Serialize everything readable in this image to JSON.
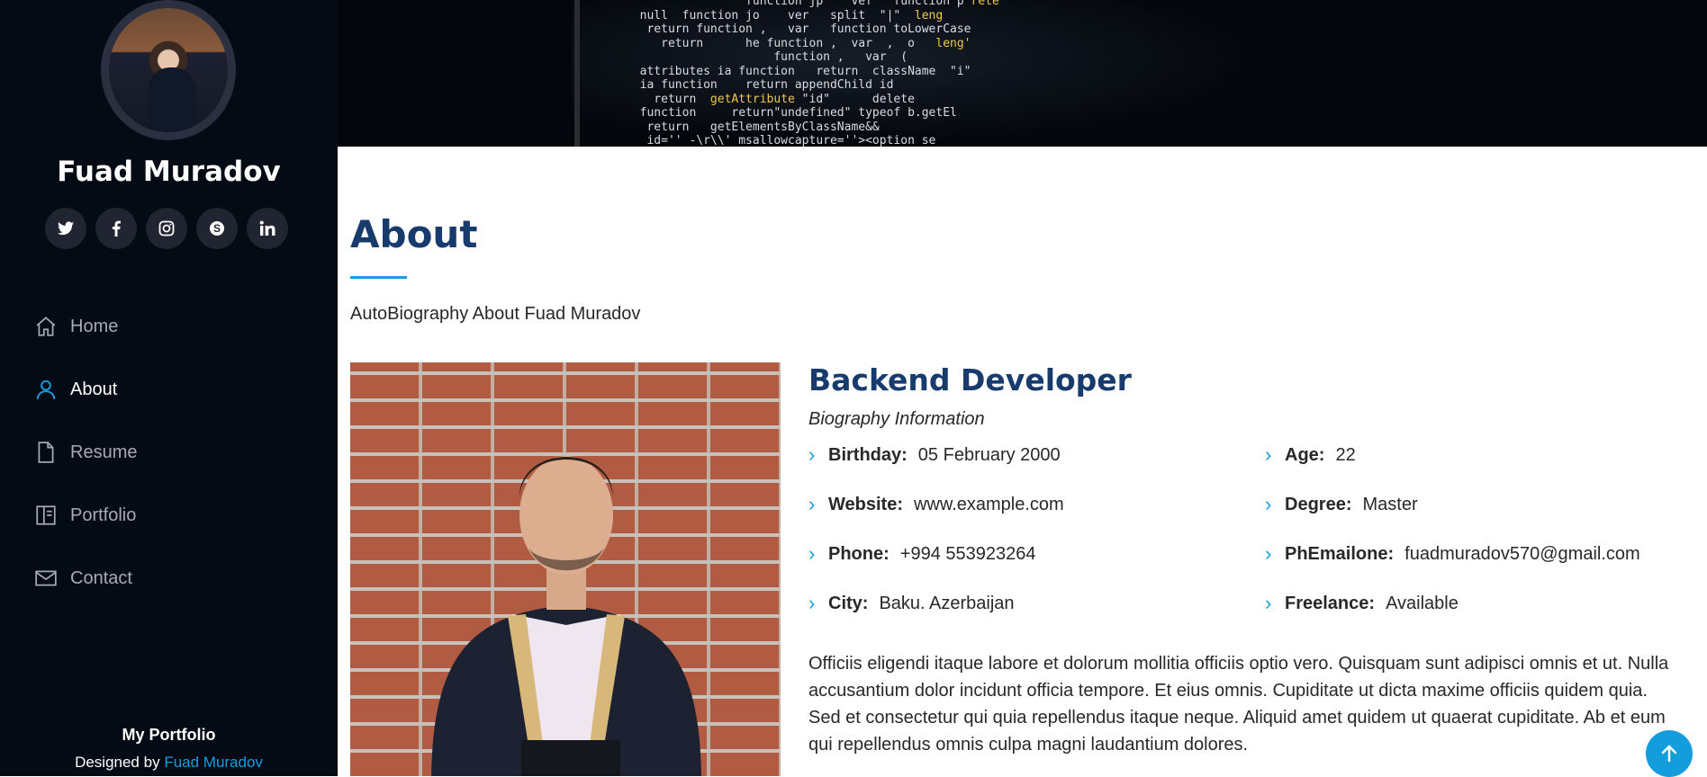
{
  "profile": {
    "name": "Fuad Muradov",
    "socials": [
      {
        "icon": "twitter-icon",
        "glyph": "𝕥"
      },
      {
        "icon": "facebook-icon",
        "glyph": "f"
      },
      {
        "icon": "instagram-icon",
        "glyph": "◎"
      },
      {
        "icon": "skype-icon",
        "glyph": "S"
      },
      {
        "icon": "linkedin-icon",
        "glyph": "in"
      }
    ]
  },
  "nav": {
    "items": [
      {
        "label": "Home",
        "icon": "home-icon"
      },
      {
        "label": "About",
        "icon": "user-icon",
        "active": true
      },
      {
        "label": "Resume",
        "icon": "file-icon"
      },
      {
        "label": "Portfolio",
        "icon": "book-icon"
      },
      {
        "label": "Contact",
        "icon": "envelope-icon"
      }
    ]
  },
  "footer": {
    "title": "My Portfolio",
    "designed_by": "Designed by",
    "author": "Fuad Muradov"
  },
  "about": {
    "title": "About",
    "lead": "AutoBiography About Fuad Muradov",
    "role": "Backend Developer",
    "subrole": "Biography Information",
    "left": [
      {
        "label": "Birthday:",
        "value": "05 February 2000"
      },
      {
        "label": "Website:",
        "value": "www.example.com"
      },
      {
        "label": "Phone:",
        "value": "+994 553923264"
      },
      {
        "label": "City:",
        "value": "Baku. Azerbaijan"
      }
    ],
    "right": [
      {
        "label": "Age:",
        "value": "22"
      },
      {
        "label": "Degree:",
        "value": "Master"
      },
      {
        "label": "PhEmailone:",
        "value": "fuadmuradov570@gmail.com"
      },
      {
        "label": "Freelance:",
        "value": "Available"
      }
    ],
    "description": "Officiis eligendi itaque labore et dolorum mollitia officiis optio vero. Quisquam sunt adipisci omnis et ut. Nulla accusantium dolor incidunt officia tempore. Et eius omnis. Cupiditate ut dicta maxime officiis quidem quia. Sed et consectetur qui quia repellendus itaque neque. Aliquid amet quidem ut quaerat cupiditate. Ab et eum qui repellendus omnis culpa magni laudantium dolores."
  },
  "colors": {
    "accent": "#149ddd",
    "heading": "#173b6c",
    "sidebar": "#040b14"
  }
}
